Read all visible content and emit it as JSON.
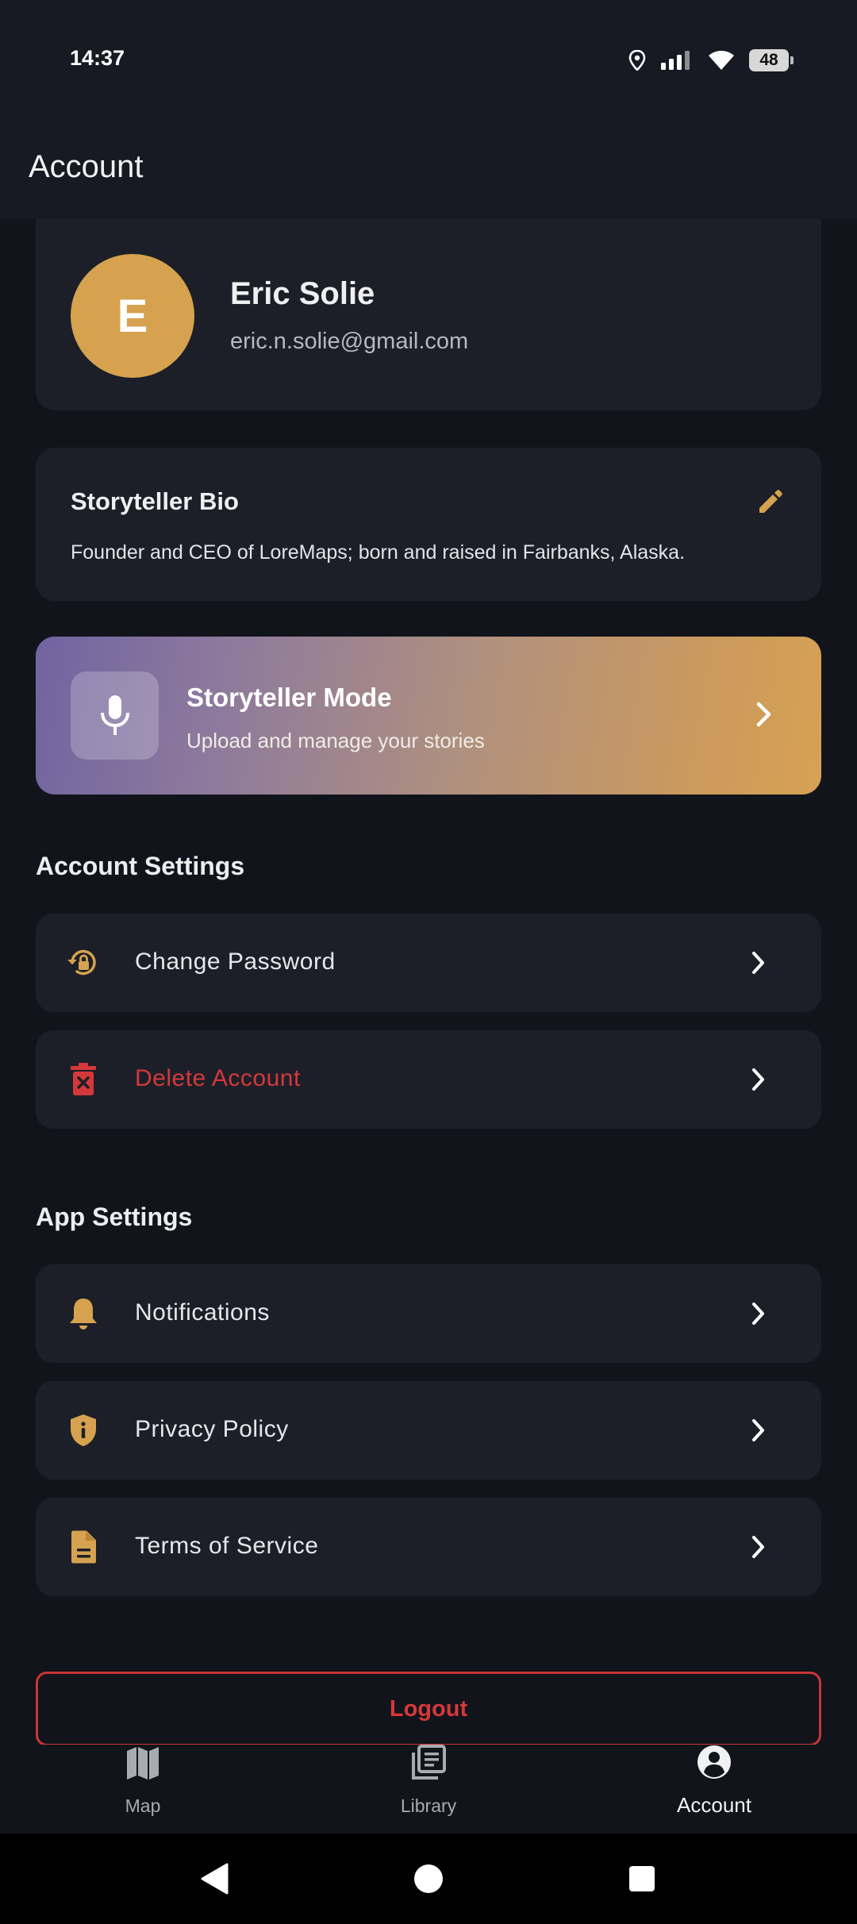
{
  "status_bar": {
    "time": "14:37",
    "battery": "48",
    "icons": [
      "location-icon",
      "signal-icon",
      "wifi-icon",
      "battery-icon"
    ]
  },
  "header": {
    "title": "Account"
  },
  "profile": {
    "initial": "E",
    "name": "Eric Solie",
    "email": "eric.n.solie@gmail.com",
    "avatar_color": "#d6a24f"
  },
  "bio": {
    "title": "Storyteller Bio",
    "text": "Founder and CEO of LoreMaps; born and raised in Fairbanks, Alaska."
  },
  "storyteller_mode": {
    "title": "Storyteller Mode",
    "subtitle": "Upload and manage your stories"
  },
  "account_settings": {
    "title": "Account Settings",
    "items": [
      {
        "label": "Change Password",
        "icon": "lock-reset-icon"
      },
      {
        "label": "Delete Account",
        "icon": "trash-icon"
      }
    ]
  },
  "app_settings": {
    "title": "App Settings",
    "items": [
      {
        "label": "Notifications",
        "icon": "bell-icon"
      },
      {
        "label": "Privacy Policy",
        "icon": "shield-icon"
      },
      {
        "label": "Terms of Service",
        "icon": "document-icon"
      }
    ]
  },
  "logout_label": "Logout",
  "bottom_nav": {
    "items": [
      {
        "label": "Map",
        "icon": "map-icon",
        "active": false
      },
      {
        "label": "Library",
        "icon": "library-icon",
        "active": false
      },
      {
        "label": "Account",
        "icon": "account-icon",
        "active": true
      }
    ]
  },
  "colors": {
    "accent": "#d6a24f",
    "danger": "#d5383a",
    "background": "#11141b",
    "card": "#1c1f28"
  }
}
